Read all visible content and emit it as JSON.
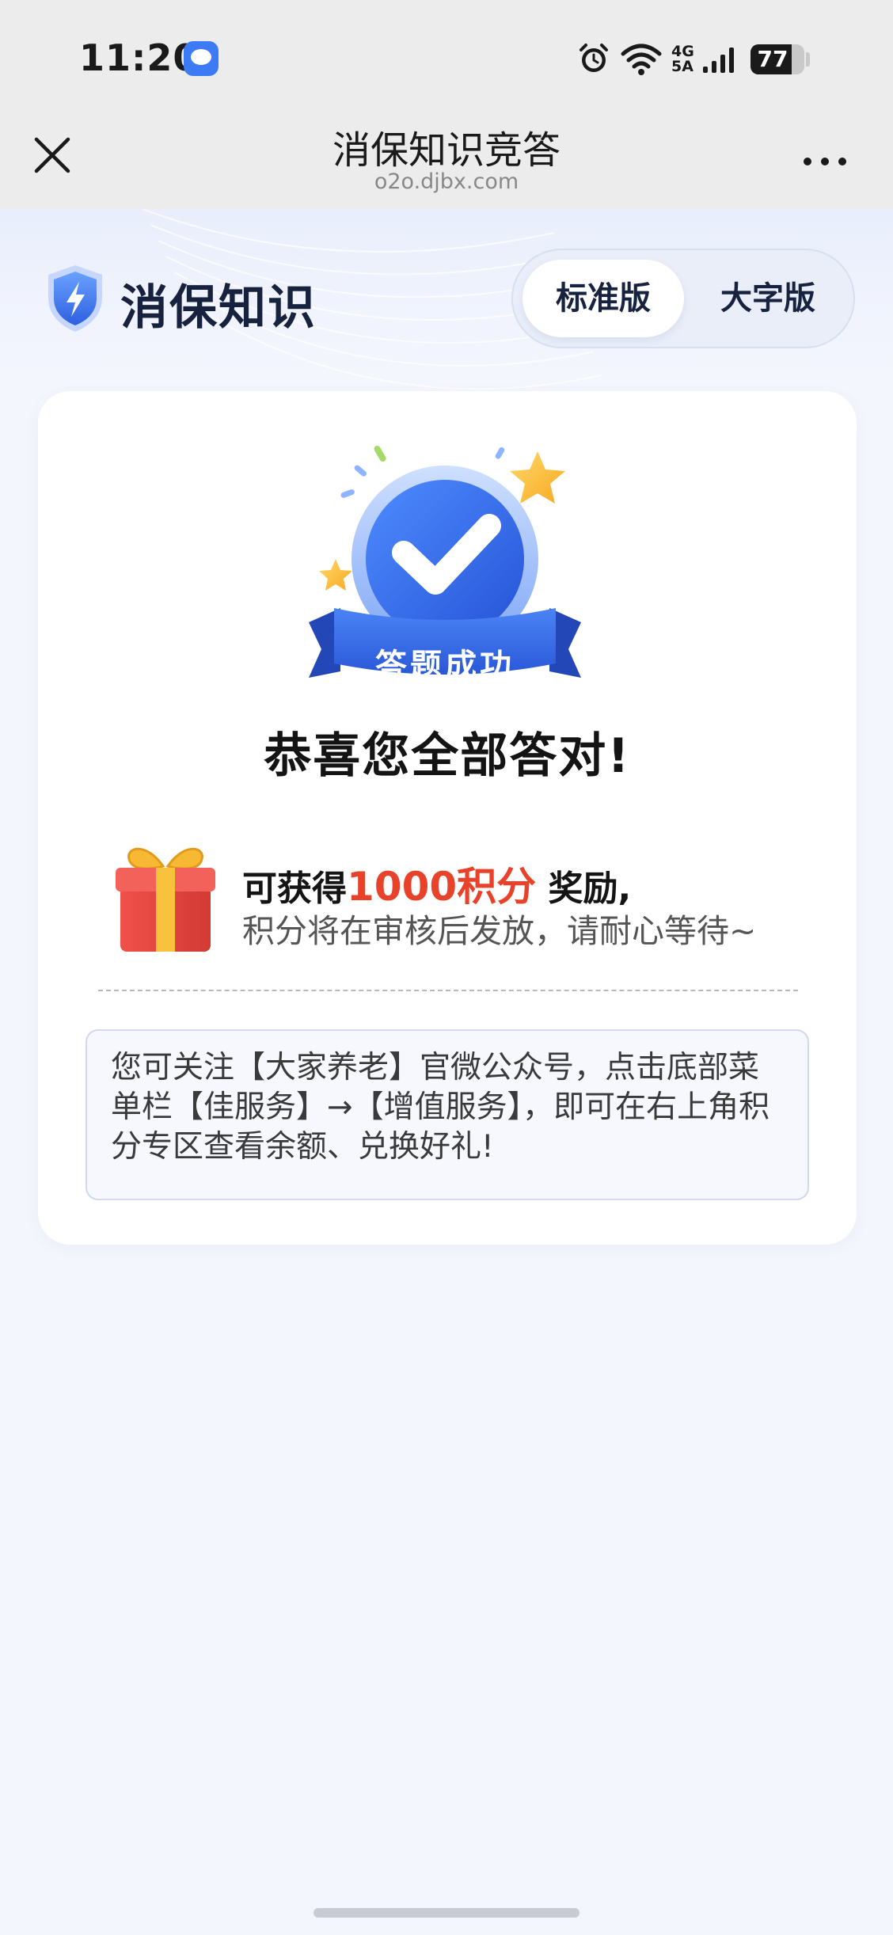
{
  "status_bar": {
    "time": "11:20",
    "network": "4G",
    "network_sub": "5A",
    "battery_level": 77,
    "battery_text": "77",
    "icons": [
      "message-icon",
      "alarm-icon",
      "wifi-icon",
      "signal-icon",
      "battery-icon"
    ]
  },
  "nav": {
    "title": "消保知识竞答",
    "url": "o2o.djbx.com",
    "close_icon": "close-icon",
    "more_icon": "more-icon"
  },
  "header": {
    "brand_title": "消保知识",
    "brand_icon": "shield-lightning-icon",
    "mode_tabs": [
      {
        "label": "标准版",
        "selected": true
      },
      {
        "label": "大字版",
        "selected": false
      }
    ]
  },
  "result": {
    "badge_label": "答题成功",
    "congrats": "恭喜您全部答对!",
    "reward_prefix": "可获得",
    "reward_points": "1000积分",
    "reward_suffix": " 奖励,",
    "reward_note": "积分将在审核后发放，请耐心等待~",
    "tip": "您可关注【大家养老】官微公众号，点击底部菜单栏【佳服务】→【增值服务】，即可在右上角积分专区查看余额、兑换好礼!"
  },
  "colors": {
    "accent_blue": "#3d7bf5",
    "reward_red": "#e8432a",
    "brand_navy": "#17223f",
    "page_bg": "#f4f6fd"
  }
}
